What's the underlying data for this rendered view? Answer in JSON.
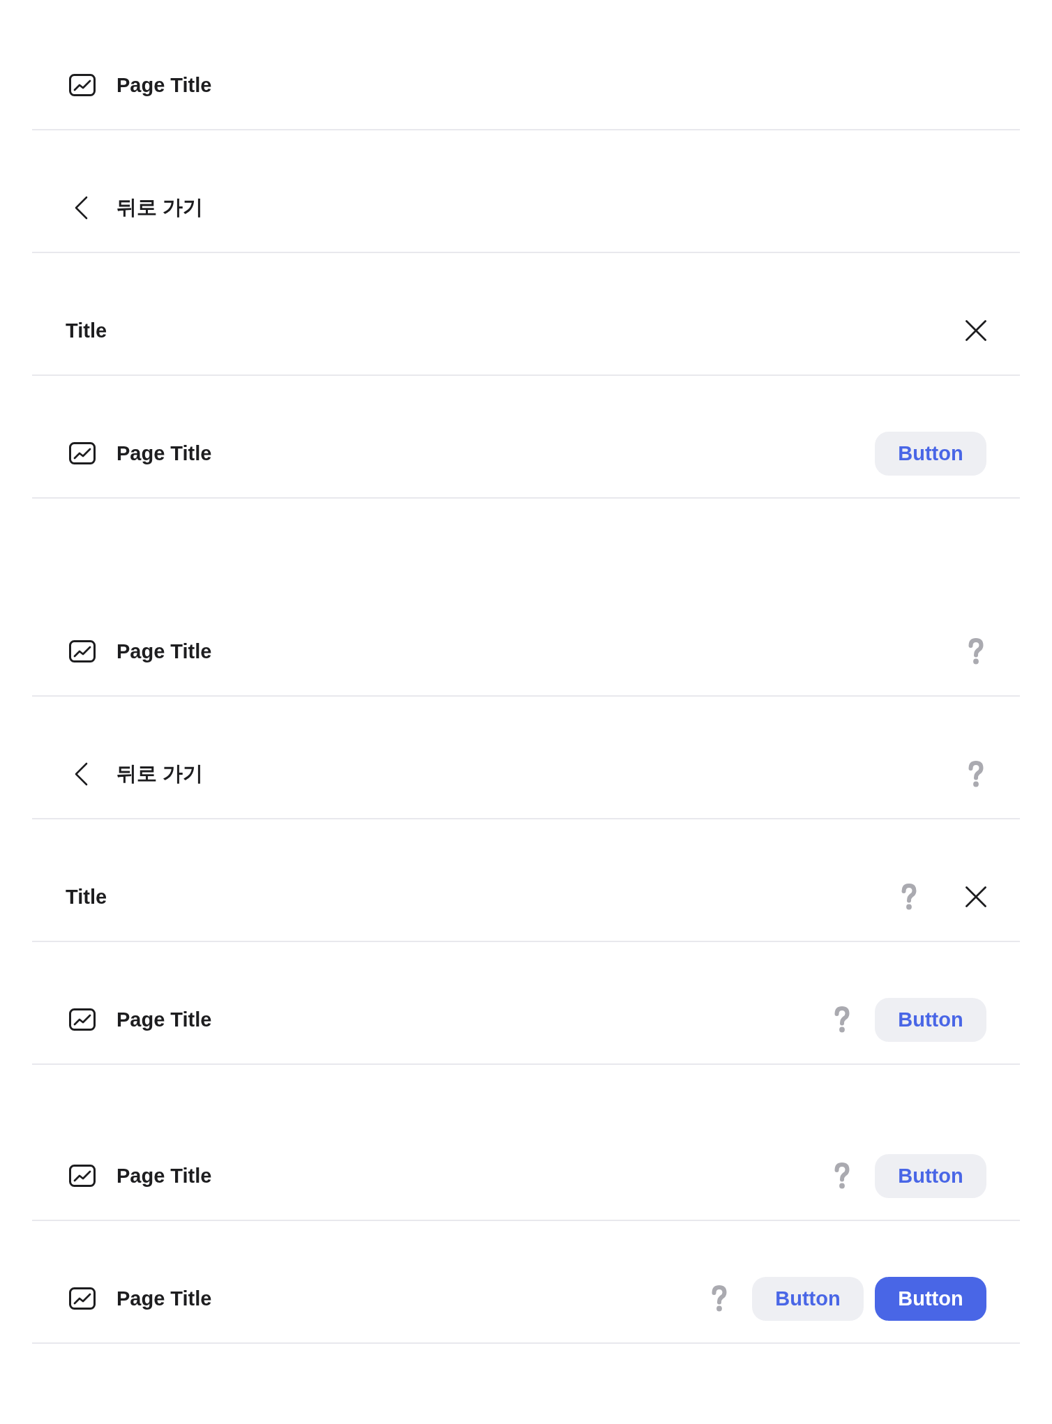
{
  "sections": [
    {
      "headers": [
        {
          "kind": "page",
          "title": "Page Title"
        },
        {
          "kind": "back",
          "title": "뒤로 가기"
        },
        {
          "kind": "plain",
          "title": "Title",
          "actions": [
            {
              "kind": "close"
            }
          ]
        },
        {
          "kind": "page",
          "title": "Page Title",
          "actions": [
            {
              "kind": "button",
              "label": "Button",
              "primary": false
            }
          ]
        }
      ]
    },
    {
      "headers": [
        {
          "kind": "page",
          "title": "Page Title",
          "actions": [
            {
              "kind": "help"
            }
          ]
        },
        {
          "kind": "back",
          "title": "뒤로 가기",
          "actions": [
            {
              "kind": "help"
            }
          ]
        },
        {
          "kind": "plain",
          "title": "Title",
          "actions": [
            {
              "kind": "help"
            },
            {
              "kind": "close"
            }
          ]
        },
        {
          "kind": "page",
          "title": "Page Title",
          "actions": [
            {
              "kind": "help"
            },
            {
              "kind": "button",
              "label": "Button",
              "primary": false
            }
          ]
        }
      ]
    },
    {
      "headers": [
        {
          "kind": "page",
          "title": "Page Title",
          "actions": [
            {
              "kind": "help"
            },
            {
              "kind": "button",
              "label": "Button",
              "primary": false
            }
          ]
        },
        {
          "kind": "page",
          "title": "Page Title",
          "actions": [
            {
              "kind": "help"
            },
            {
              "kind": "button",
              "label": "Button",
              "primary": false
            },
            {
              "kind": "button",
              "label": "Button",
              "primary": true
            }
          ]
        }
      ]
    }
  ]
}
